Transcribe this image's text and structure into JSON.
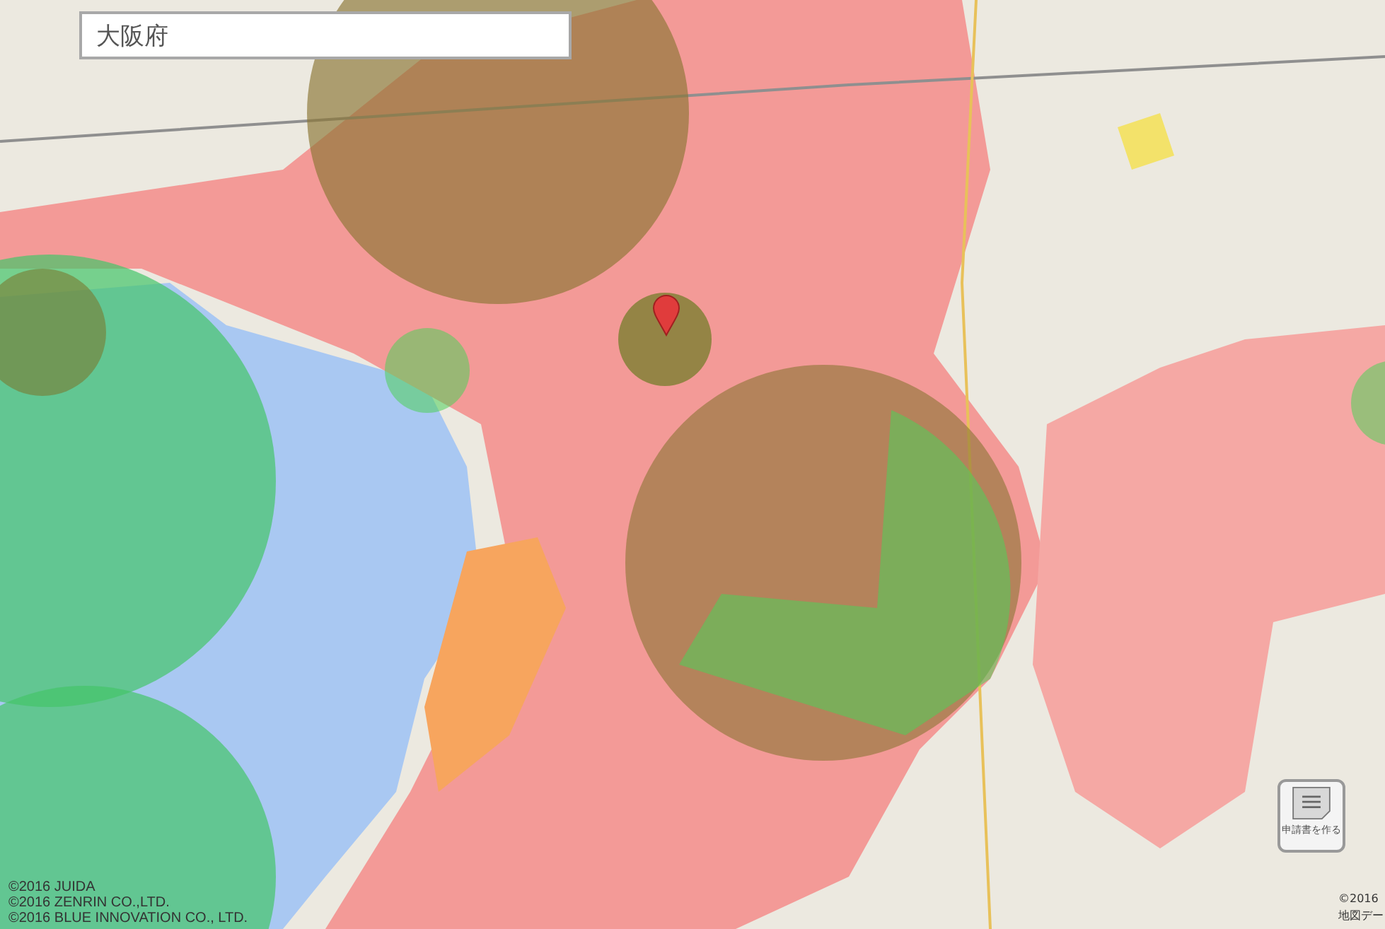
{
  "search": {
    "value": "大阪府"
  },
  "apply_button": {
    "label": "申請書を作る"
  },
  "copyright": [
    "©2016 JUIDA",
    "©2016 ZENRIN CO.,LTD.",
    "©2016 BLUE INNOVATION CO., LTD."
  ],
  "map_credit": [
    "©2016",
    "地図デー"
  ]
}
